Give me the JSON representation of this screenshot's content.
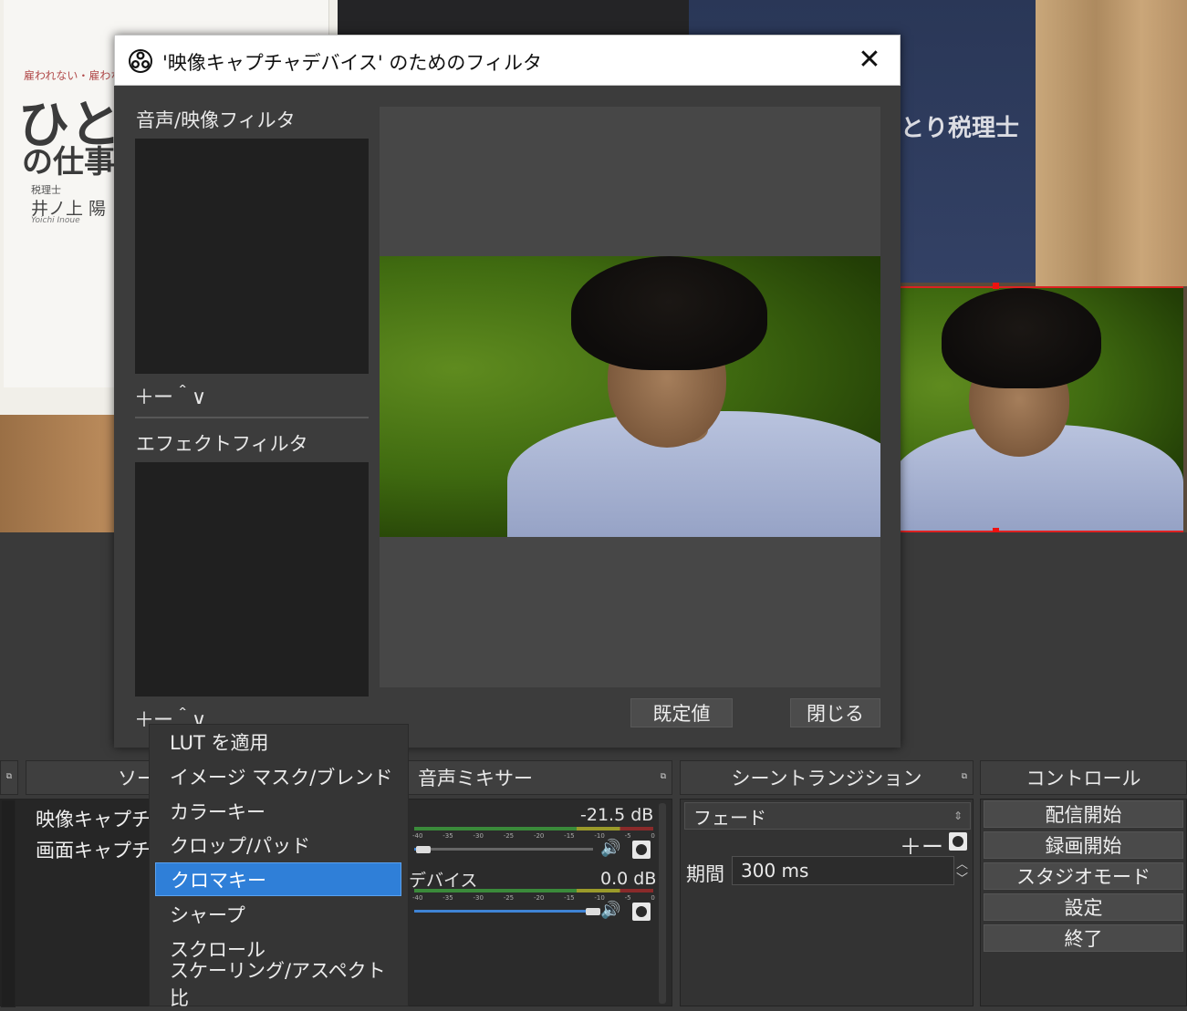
{
  "background": {
    "book_tag": "雇われない・雇わない",
    "book_title_big": "ひと",
    "book_title_mid": "の仕事",
    "book_author_role": "税理士",
    "book_author": "井ノ上 陽",
    "book_author_roman": "Yoichi Inoue",
    "navy_book_title": "とり税理士"
  },
  "dialog": {
    "title": "'映像キャプチャデバイス' のためのフィルタ",
    "close_glyph": "✕",
    "av_filters_label": "音声/映像フィルタ",
    "effect_filters_label": "エフェクトフィルタ",
    "toolbar_glyphs": "＋ー＾∨",
    "defaults_button": "既定値",
    "close_button": "閉じる"
  },
  "context_menu": {
    "items": [
      "LUT を適用",
      "イメージ マスク/ブレンド",
      "カラーキー",
      "クロップ/パッド",
      "クロマキー",
      "シャープ",
      "スクロール",
      "スケーリング/アスペクト比"
    ],
    "active_index": 4
  },
  "sources": {
    "header": "ソース",
    "items": [
      "映像キャプチャデバイス",
      "画面キャプチャ"
    ]
  },
  "mixer": {
    "header": "音声ミキサー",
    "channels": [
      {
        "name": "",
        "db": "-21.5 dB",
        "volume": 0.05
      },
      {
        "name": "デバイス",
        "db": "0.0 dB",
        "volume": 1.0
      }
    ],
    "ticks": [
      "-40",
      "-35",
      "-30",
      "-25",
      "-20",
      "-15",
      "-10",
      "-5",
      "0"
    ],
    "speaker_glyph": "🔊"
  },
  "transitions": {
    "header": "シーントランジション",
    "selected": "フェード",
    "tools": "＋ー",
    "duration_label": "期間",
    "duration_value": "300 ms"
  },
  "controls": {
    "header": "コントロール",
    "buttons": [
      "配信開始",
      "録画開始",
      "スタジオモード",
      "設定",
      "終了"
    ]
  },
  "colors": {
    "selection_outline": "#dd1111",
    "menu_highlight": "#2f7fd8",
    "slider_fill": "#3f84d6"
  }
}
